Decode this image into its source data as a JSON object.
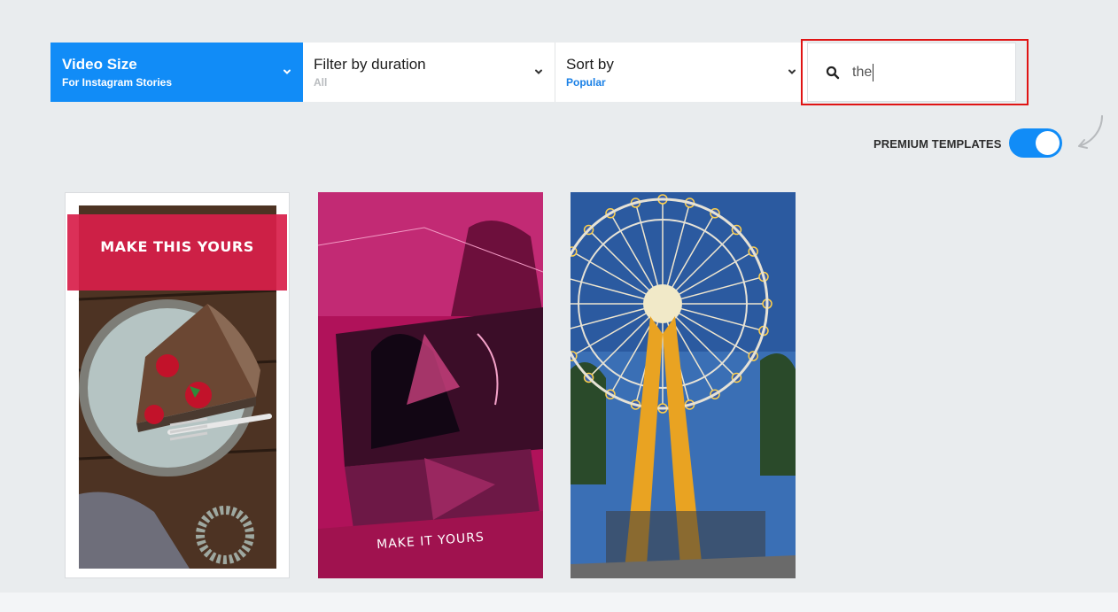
{
  "filters": {
    "size": {
      "title": "Video Size",
      "value": "For Instagram Stories"
    },
    "duration": {
      "title": "Filter by duration",
      "value": "All"
    },
    "sort": {
      "title": "Sort by",
      "value": "Popular"
    }
  },
  "search": {
    "value": "the",
    "icon": "search-icon"
  },
  "premium": {
    "label": "PREMIUM TEMPLATES",
    "enabled": true
  },
  "templates": [
    {
      "title": "MAKE THIS YOURS"
    },
    {
      "title": "MAKE IT YOURS"
    },
    {
      "title": ""
    }
  ],
  "colors": {
    "accent": "#118cf7",
    "highlight": "#e01414",
    "background": "#e9ecee"
  }
}
